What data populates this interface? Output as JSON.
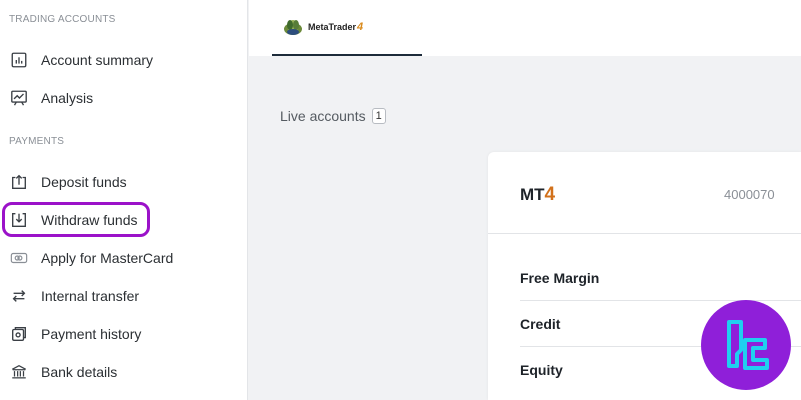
{
  "sidebar": {
    "trading_section": "TRADING ACCOUNTS",
    "trading_items": [
      {
        "label": "Account summary",
        "icon": "bar-chart-icon"
      },
      {
        "label": "Analysis",
        "icon": "trend-chart-icon"
      }
    ],
    "payments_section": "PAYMENTS",
    "payment_items": [
      {
        "label": "Deposit funds",
        "icon": "upload-tray-icon"
      },
      {
        "label": "Withdraw funds",
        "icon": "download-tray-icon"
      },
      {
        "label": "Apply for MasterCard",
        "icon": "card-icon"
      },
      {
        "label": "Internal transfer",
        "icon": "arrows-swap-icon"
      },
      {
        "label": "Payment history",
        "icon": "history-icon"
      },
      {
        "label": "Bank details",
        "icon": "bank-icon"
      }
    ],
    "highlight_color": "#9b12c9"
  },
  "tabs": [
    {
      "label": "MetaTrader",
      "number": "4",
      "active": true
    }
  ],
  "main": {
    "live_accounts_label": "Live accounts",
    "live_accounts_count": "1",
    "card": {
      "platform": "MT",
      "platform_version": "4",
      "account_number": "4000070",
      "rows": [
        "Free Margin",
        "Credit",
        "Equity"
      ]
    }
  },
  "brand": {
    "color": "#8f1fd9"
  }
}
